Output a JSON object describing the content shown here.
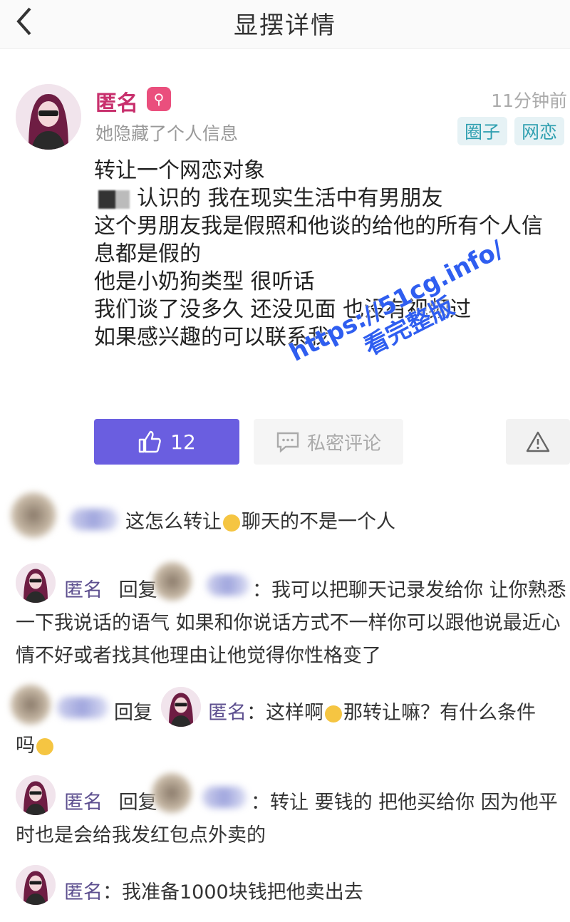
{
  "header": {
    "title": "显摆详情",
    "back_icon": "chevron-left-icon"
  },
  "post": {
    "author": "匿名",
    "author_sub": "她隐藏了个人信息",
    "time": "11分钟前",
    "tags": [
      "圈子",
      "网恋"
    ],
    "lines": [
      "转让一个网恋对象",
      "认识的 我在现实生活中有男朋友",
      "这个男朋友我是假照和他谈的给他的所有个人信",
      "息都是假的",
      "他是小奶狗类型 很听话",
      "我们谈了没多久 还没见面 也没有视频过",
      "如果感兴趣的可以联系我"
    ],
    "like_count": "12",
    "dm_label": "私密评论",
    "accent_color": "#6a5ee0"
  },
  "watermark": {
    "line1": "https://51cg.info/",
    "line2": "看完整版"
  },
  "comments": [
    {
      "text_a": "这怎么转让",
      "text_b": "聊天的不是一个人"
    },
    {
      "author": "匿名",
      "reply": "回复",
      "lines": [
        "：我可以把聊天记录发给你 让你熟悉",
        "一下我说话的语气 如果和你说话方式不一样你可以跟他说最近心",
        "情不好或者找其他理由让他觉得你性格变了"
      ]
    },
    {
      "reply": "回复",
      "target": "匿名",
      "text_a": "：这样啊",
      "text_b": "那转让嘛？有什么条件",
      "text_c": "吗"
    },
    {
      "author": "匿名",
      "reply": "回复",
      "lines": [
        "：转让 要钱的 把他买给你 因为他平",
        "时也是会给我发红包点外卖的"
      ]
    },
    {
      "author": "匿名",
      "text": "：我准备1000块钱把他卖出去"
    }
  ]
}
